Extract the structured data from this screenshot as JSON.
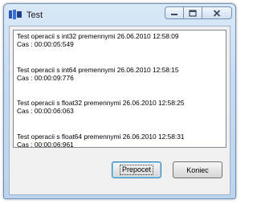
{
  "window": {
    "title": "Test"
  },
  "log": {
    "entries": [
      {
        "line1": "Test operacii s int32 premennymi 26.06.2010 12:58:09",
        "line2": "Cas : 00:00:05:549"
      },
      {
        "line1": "Test operacii s int64 premennymi 26.06.2010 12:58:15",
        "line2": "Cas : 00:00:09:776"
      },
      {
        "line1": "Test operacii s float32 premennymi 26.06.2010 12:58:25",
        "line2": "Cas : 00:00:06:063"
      },
      {
        "line1": "Test operacii s float64 premennymi 26.06.2010 12:58:31",
        "line2": "Cas : 00:00:06:961"
      }
    ]
  },
  "buttons": {
    "recalc_label": "Prepocet",
    "end_label": "Koniec"
  },
  "icons": {
    "app": "app-icon",
    "minimize": "minimize-icon",
    "maximize": "maximize-icon",
    "close": "close-icon"
  }
}
